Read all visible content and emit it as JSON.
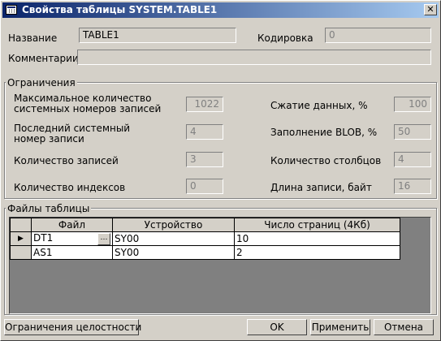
{
  "title": "Свойства таблицы SYSTEM.TABLE1",
  "name_label": "Название",
  "name_value": "TABLE1",
  "encoding_label": "Кодировка",
  "encoding_value": "0",
  "comment_label": "Комментарии",
  "comment_value": "",
  "limits": {
    "group_label": "Ограничения",
    "max_records_label_1": "Максимальное количество",
    "max_records_label_2": "системных номеров записей",
    "max_records_value": "1022",
    "compression_label": "Сжатие данных, %",
    "compression_value": "100",
    "last_record_label_1": "Последний системный",
    "last_record_label_2": "номер записи",
    "last_record_value": "4",
    "blob_fill_label": "Заполнение BLOB, %",
    "blob_fill_value": "50",
    "records_count_label": "Количество записей",
    "records_count_value": "3",
    "columns_count_label": "Количество столбцов",
    "columns_count_value": "4",
    "indexes_count_label": "Количество индексов",
    "indexes_count_value": "0",
    "record_length_label": "Длина записи, байт",
    "record_length_value": "16"
  },
  "files": {
    "group_label": "Файлы таблицы",
    "columns": [
      "Файл",
      "Устройство",
      "Число страниц (4Кб)"
    ],
    "rows": [
      {
        "file": "DT1",
        "device": "SY00",
        "pages": "10",
        "current": true
      },
      {
        "file": "AS1",
        "device": "SY00",
        "pages": "2",
        "current": false
      }
    ]
  },
  "buttons": {
    "integrity": "Ограничения целостности",
    "ok": "OK",
    "apply": "Применить",
    "cancel": "Отмена"
  },
  "icons": {
    "window": "table-icon",
    "close": "close-icon",
    "row_indicator": "triangle-right-icon",
    "ellipsis": "ellipsis-button"
  }
}
